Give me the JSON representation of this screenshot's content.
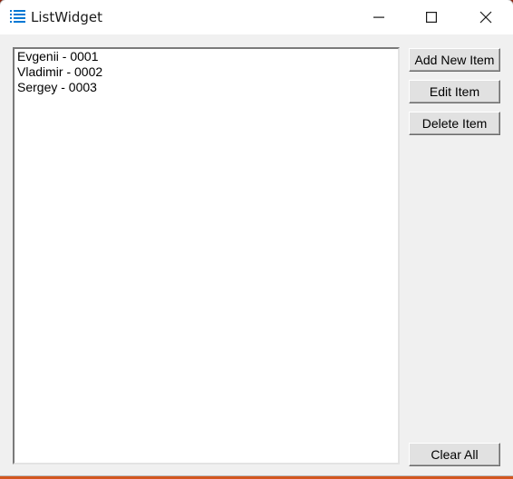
{
  "window": {
    "title": "ListWidget",
    "app_icon": "list-icon",
    "controls": [
      "minimize-icon",
      "maximize-icon",
      "close-icon"
    ]
  },
  "list": {
    "items": [
      "Evgenii - 0001",
      "Vladimir - 0002",
      "Sergey - 0003"
    ]
  },
  "buttons": {
    "add": "Add New Item",
    "edit": "Edit Item",
    "delete": "Delete Item",
    "clear": "Clear All"
  },
  "colors": {
    "app_icon": "#0078d4",
    "window_bg": "#f0f0f0",
    "button_bg": "#e1e1e1"
  }
}
